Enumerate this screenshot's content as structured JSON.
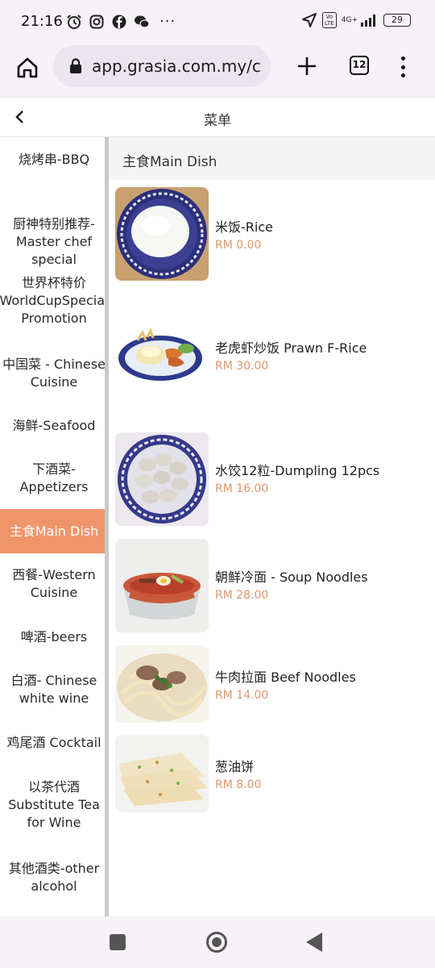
{
  "status_bar": {
    "time": "21:16",
    "mobile_data": "4G+",
    "volte": "Vo LTE",
    "battery": "29"
  },
  "browser": {
    "url": "app.grasia.com.my/c",
    "tab_count": "12"
  },
  "header": {
    "title": "菜单"
  },
  "categories": [
    {
      "label": "烧烤串-BBQ"
    },
    {
      "label": "厨神特别推荐-Master chef special"
    },
    {
      "label": "世界杯特价 WorldCupSpecial Promotion"
    },
    {
      "label": "中国菜 - Chinese Cuisine"
    },
    {
      "label": "海鲜-Seafood"
    },
    {
      "label": "下酒菜-Appetizers"
    },
    {
      "label": "主食Main Dish"
    },
    {
      "label": "西餐-Western Cuisine"
    },
    {
      "label": "啤酒-beers"
    },
    {
      "label": "白酒- Chinese white wine"
    },
    {
      "label": "鸡尾酒 Cocktail"
    },
    {
      "label": "以茶代酒 Substitute Tea for Wine"
    },
    {
      "label": "其他酒类-other alcohol"
    }
  ],
  "section": {
    "title": "主食Main Dish"
  },
  "dishes": [
    {
      "name": "米饭-Rice",
      "price": "RM 0.00"
    },
    {
      "name": "老虎虾炒饭 Prawn F-Rice",
      "price": "RM 30.00"
    },
    {
      "name": "水饺12粒-Dumpling 12pcs",
      "price": "RM 16.00"
    },
    {
      "name": "朝鲜冷面 - Soup Noodles",
      "price": "RM 28.00"
    },
    {
      "name": "牛肉拉面 Beef Noodles",
      "price": "RM 14.00"
    },
    {
      "name": "葱油饼",
      "price": "RM 8.00"
    }
  ],
  "colors": {
    "accent": "#f0956a",
    "price": "#e0976c"
  }
}
